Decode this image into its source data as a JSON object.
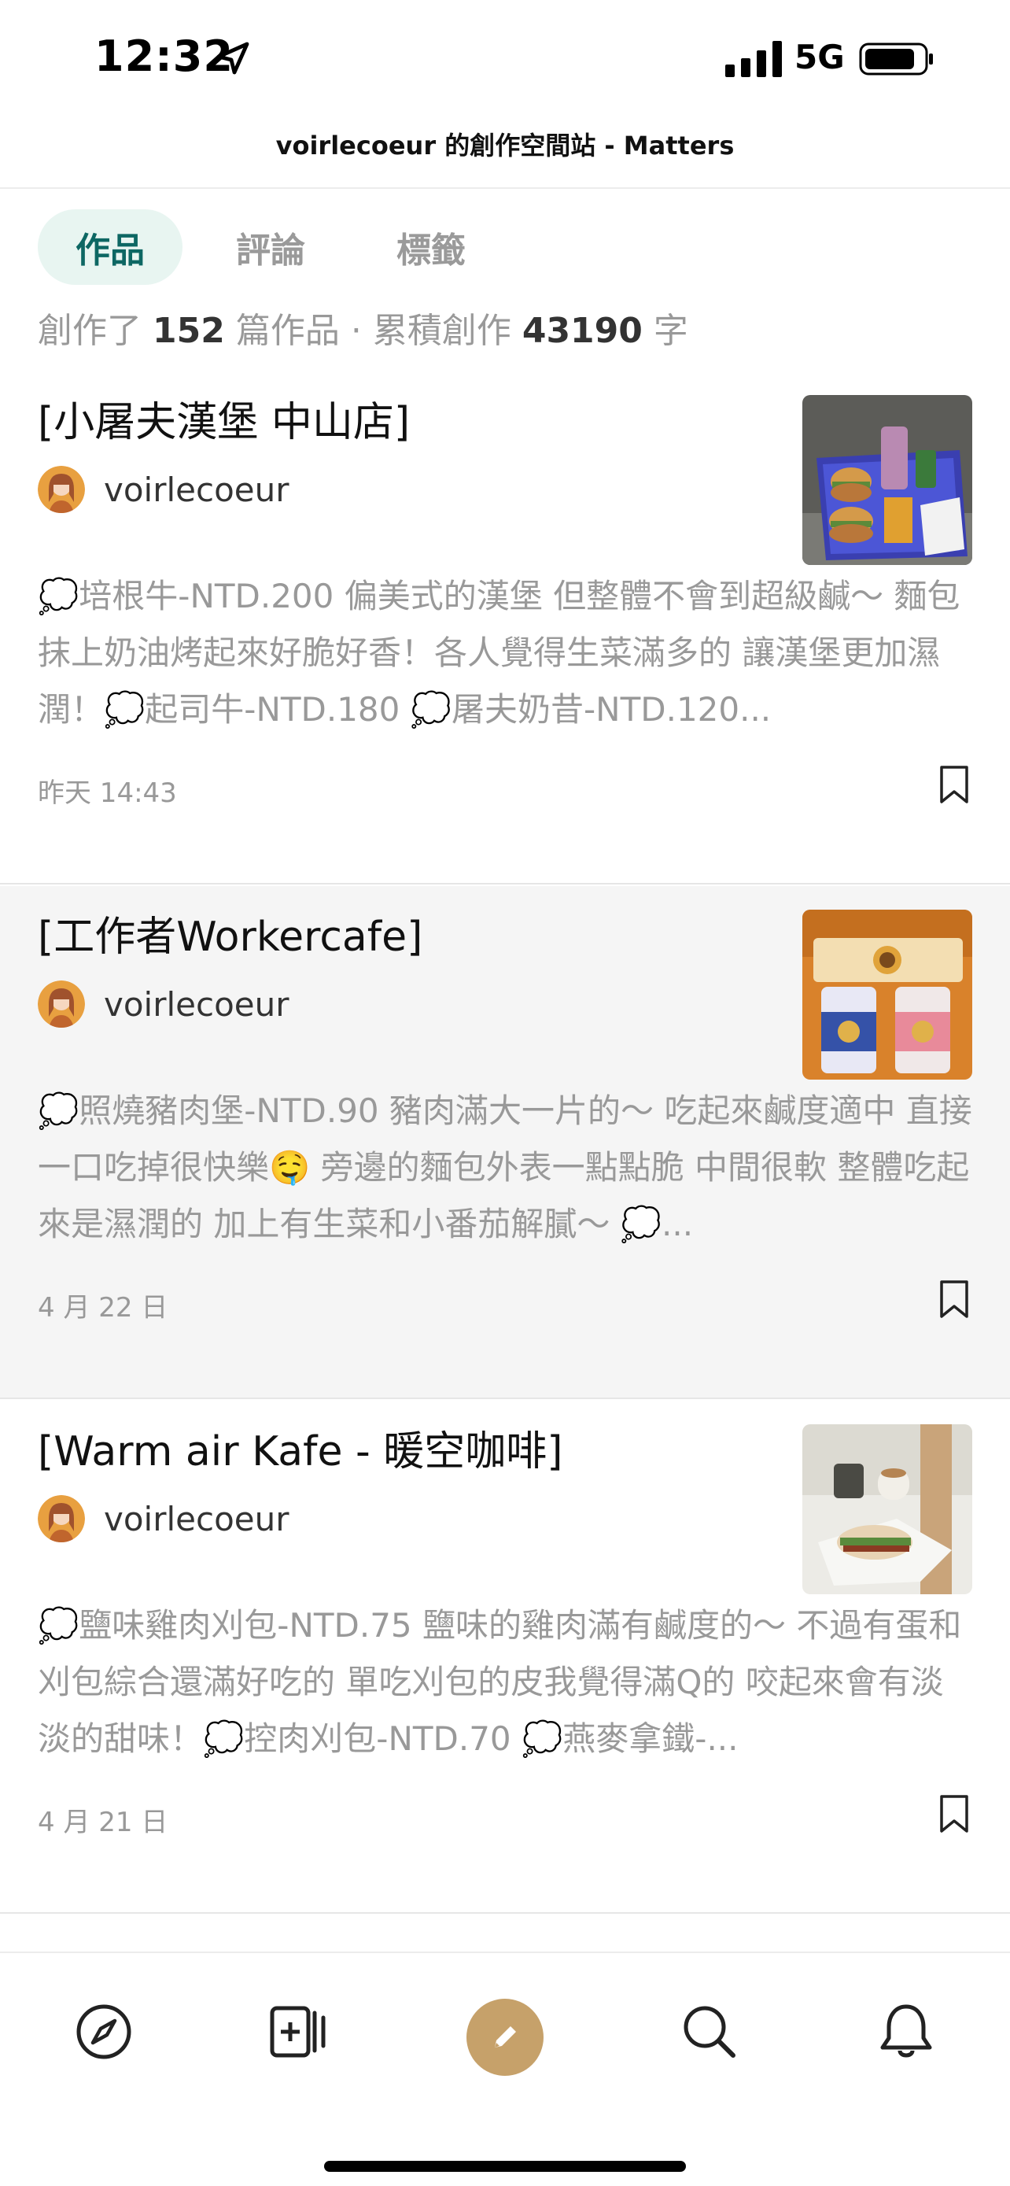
{
  "status_bar": {
    "time": "12:32",
    "network": "5G",
    "icons": [
      "location-arrow-icon",
      "signal-icon",
      "battery-icon"
    ]
  },
  "header": {
    "title": "voirlecoeur 的創作空間站 - Matters"
  },
  "tabs": [
    {
      "label": "作品",
      "active": true
    },
    {
      "label": "評論",
      "active": false
    },
    {
      "label": "標籤",
      "active": false
    }
  ],
  "stats": {
    "prefix": "創作了",
    "works_count": "152",
    "works_unit": "篇作品 · 累積創作",
    "chars_count": "43190",
    "chars_unit": "字"
  },
  "articles": [
    {
      "title": "[小屠夫漢堡 中山店]",
      "author": "voirlecoeur",
      "summary": "💭培根牛-NTD.200 偏美式的漢堡 但整體不會到超級鹹～ 麵包抹上奶油烤起來好脆好香！各人覺得生菜滿多的 讓漢堡更加濕潤！💭起司牛-NTD.180 💭屠夫奶昔-NTD.120...",
      "date": "昨天 14:43",
      "thumbnail": "burger-tray-photo"
    },
    {
      "title": "[工作者Workercafe]",
      "author": "voirlecoeur",
      "summary": "💭照燒豬肉堡-NTD.90 豬肉滿大一片的～ 吃起來鹹度適中 直接一口吃掉很快樂🤤 旁邊的麵包外表一點點脆 中間很軟 整體吃起來是濕潤的 加上有生菜和小番茄解膩～ 💭...",
      "date": "4 月 22 日",
      "thumbnail": "cafe-cups-photo"
    },
    {
      "title": "[Warm air Kafe - 暖空咖啡]",
      "author": "voirlecoeur",
      "summary": "💭鹽味雞肉刈包-NTD.75 鹽味的雞肉滿有鹹度的～ 不過有蛋和刈包綜合還滿好吃的 單吃刈包的皮我覺得滿Q的 咬起來會有淡淡的甜味！💭控肉刈包-NTD.70 💭燕麥拿鐵-...",
      "date": "4 月 21 日",
      "thumbnail": "gua-bao-coffee-photo"
    }
  ],
  "tab_bar": {
    "items": [
      "compass-icon",
      "add-card-icon",
      "write-pen-icon",
      "search-icon",
      "bell-icon"
    ],
    "accent_color": "#c6a16a"
  },
  "colors": {
    "active_tab_bg": "#e8f5f1",
    "active_tab_text": "#0d6763"
  }
}
